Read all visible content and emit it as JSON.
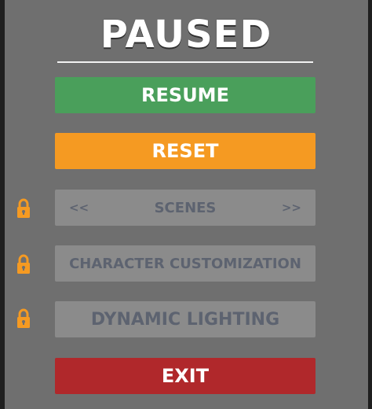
{
  "pause_menu": {
    "title": "PAUSED",
    "buttons": {
      "resume": "RESUME",
      "reset": "RESET",
      "scenes": {
        "label": "SCENES",
        "prev": "<<",
        "next": ">>",
        "locked": true
      },
      "character_customization": {
        "label": "CHARACTER CUSTOMIZATION",
        "locked": true
      },
      "dynamic_lighting": {
        "label": "DYNAMIC LIGHTING",
        "locked": true
      },
      "exit": "EXIT"
    },
    "icons": {
      "lock": "lock-icon"
    },
    "colors": {
      "panel_bg": "#6f6f6f",
      "resume": "#4a9f5b",
      "reset": "#f59a22",
      "locked_button": "#8b8b8b",
      "locked_text": "#5d6370",
      "exit": "#b0282b",
      "lock_icon": "#f59a22"
    }
  }
}
